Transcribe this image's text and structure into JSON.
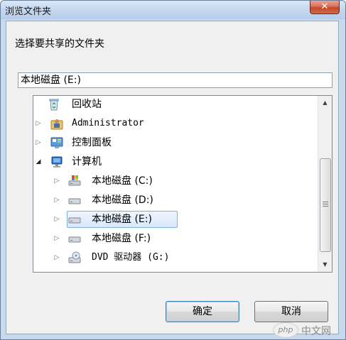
{
  "window": {
    "title": "浏览文件夹",
    "close_glyph": "✕"
  },
  "dialog": {
    "prompt": "选择要共享的文件夹",
    "path_value": "本地磁盘 (E:)"
  },
  "tree": {
    "items": [
      {
        "label": "回收站",
        "icon": "recycle-bin-icon",
        "expander": "",
        "selected": false
      },
      {
        "label": "Administrator",
        "icon": "user-folder-icon",
        "expander": "collapsed",
        "selected": false
      },
      {
        "label": "控制面板",
        "icon": "control-panel-icon",
        "expander": "collapsed",
        "selected": false
      },
      {
        "label": "计算机",
        "icon": "computer-icon",
        "expander": "expanded",
        "selected": false
      },
      {
        "label": "本地磁盘 (C:)",
        "icon": "system-drive-icon",
        "expander": "collapsed",
        "selected": false
      },
      {
        "label": "本地磁盘 (D:)",
        "icon": "hard-drive-icon",
        "expander": "collapsed",
        "selected": false
      },
      {
        "label": "本地磁盘 (E:)",
        "icon": "hard-drive-icon",
        "expander": "collapsed",
        "selected": true
      },
      {
        "label": "本地磁盘 (F:)",
        "icon": "hard-drive-icon",
        "expander": "collapsed",
        "selected": false
      },
      {
        "label": "DVD 驱动器 (G:)",
        "icon": "dvd-drive-icon",
        "expander": "collapsed",
        "selected": false
      }
    ]
  },
  "buttons": {
    "ok_label": "确定",
    "cancel_label": "取消"
  },
  "watermark": {
    "logo_text": "php",
    "site_text": "中文网"
  },
  "colors": {
    "selection_border": "#84acdd",
    "close_button": "#c2472d",
    "window_frame": "#c7d9ee"
  }
}
